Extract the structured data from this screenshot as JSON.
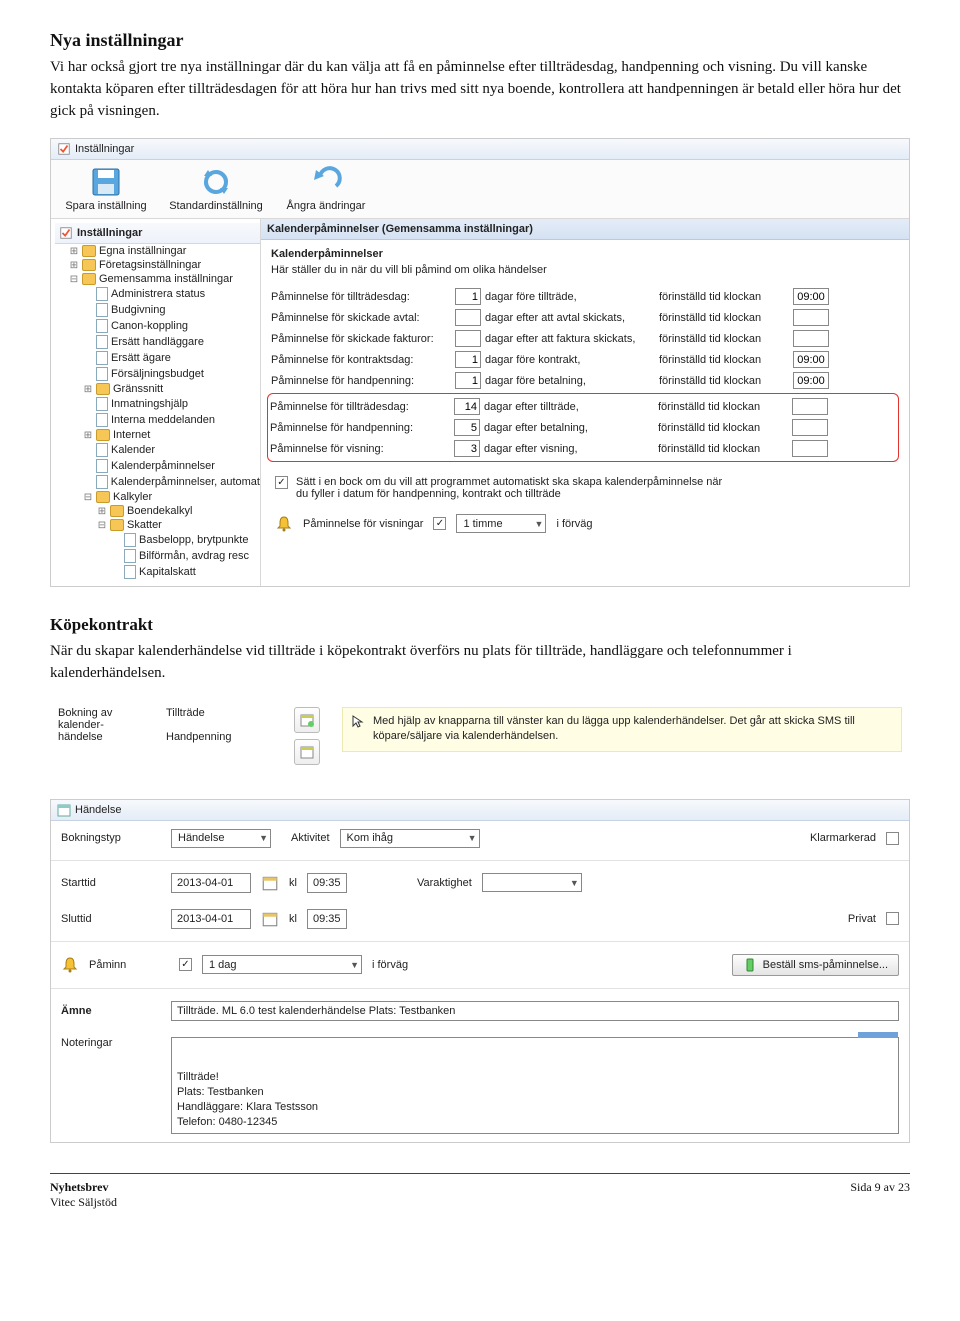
{
  "doc": {
    "h1": "Nya inställningar",
    "p1": "Vi har också gjort tre nya inställningar där du kan välja att få en påminnelse efter tillträdesdag, handpenning och visning. Du vill kanske kontakta köparen efter tillträdesdagen för att höra hur han trivs med sitt nya boende, kontrollera att handpenningen är betald eller höra hur det gick på visningen.",
    "h2": "Köpekontrakt",
    "p2": "När du skapar kalenderhändelse vid tillträde i köpekontrakt överförs nu plats för tillträde, handläggare och telefonnummer i kalenderhändelsen."
  },
  "ss1": {
    "title": "Inställningar",
    "tool_save": "Spara inställning",
    "tool_std": "Standardinställning",
    "tool_undo": "Ångra ändringar",
    "tree_hdr": "Inställningar",
    "tree": [
      "Egna inställningar",
      "Företagsinställningar",
      "Gemensamma inställningar",
      "Administrera status",
      "Budgivning",
      "Canon-koppling",
      "Ersätt handläggare",
      "Ersätt ägare",
      "Försäljningsbudget",
      "Gränssnitt",
      "Inmatningshjälp",
      "Interna meddelanden",
      "Internet",
      "Kalender",
      "Kalenderpåminnelser",
      "Kalenderpåminnelser, automat",
      "Kalkyler",
      "Boendekalkyl",
      "Skatter",
      "Basbelopp, brytpunkte",
      "Bilförmån, avdrag resc",
      "Kapitalskatt"
    ],
    "section": "Kalenderpåminnelser (Gemensamma inställningar)",
    "subtitle": "Kalenderpåminnelser",
    "desc": "Här ställer du in när du vill bli påmind om olika händelser",
    "rows_top": [
      {
        "l": "Påminnelse för tillträdesdag:",
        "v": "1",
        "m": "dagar före tillträde,",
        "p": "förinställd tid klockan",
        "t": "09:00"
      },
      {
        "l": "Påminnelse för skickade avtal:",
        "v": "",
        "m": "dagar efter att avtal skickats,",
        "p": "förinställd tid klockan",
        "t": ""
      },
      {
        "l": "Påminnelse för skickade fakturor:",
        "v": "",
        "m": "dagar efter att faktura skickats,",
        "p": "förinställd tid klockan",
        "t": ""
      },
      {
        "l": "Påminnelse för kontraktsdag:",
        "v": "1",
        "m": "dagar före kontrakt,",
        "p": "förinställd tid klockan",
        "t": "09:00"
      },
      {
        "l": "Påminnelse för handpenning:",
        "v": "1",
        "m": "dagar före betalning,",
        "p": "förinställd tid klockan",
        "t": "09:00"
      }
    ],
    "rows_red": [
      {
        "l": "Påminnelse för tillträdesdag:",
        "v": "14",
        "m": "dagar efter tillträde,",
        "p": "förinställd tid klockan",
        "t": ""
      },
      {
        "l": "Påminnelse för handpenning:",
        "v": "5",
        "m": "dagar efter betalning,",
        "p": "förinställd tid klockan",
        "t": ""
      },
      {
        "l": "Påminnelse för visning:",
        "v": "3",
        "m": "dagar efter visning,",
        "p": "förinställd tid klockan",
        "t": ""
      }
    ],
    "check_text": "Sätt i en bock om du vill att programmet automatiskt ska skapa kalenderpåminnelse när du fyller i datum för handpenning, kontrakt och tillträde",
    "bell_label": "Påminnelse för visningar",
    "bell_value": "1 timme",
    "bell_suffix": "i förväg"
  },
  "ss2": {
    "col1": "Bokning av kalender-händelse",
    "btn1": "Tillträde",
    "btn2": "Handpenning",
    "help": "Med hjälp av knapparna till vänster kan du lägga upp kalenderhändelser. Det går att skicka SMS till köpare/säljare via kalenderhändelsen."
  },
  "ss3": {
    "title": "Händelse",
    "l_bokning": "Bokningstyp",
    "v_bokning": "Händelse",
    "l_aktivitet": "Aktivitet",
    "v_aktivitet": "Kom ihåg",
    "l_klar": "Klarmarkerad",
    "l_start": "Starttid",
    "v_start_d": "2013-04-01",
    "l_kl": "kl",
    "v_start_t": "09:35",
    "l_var": "Varaktighet",
    "l_slut": "Sluttid",
    "v_slut_d": "2013-04-01",
    "v_slut_t": "09:35",
    "l_privat": "Privat",
    "l_paminn": "Påminn",
    "v_paminn": "1 dag",
    "paminn_suffix": "i förväg",
    "btn_sms": "Beställ sms-påminnelse...",
    "l_amne": "Ämne",
    "v_amne": "Tillträde. ML 6.0 test kalenderhändelse Plats: Testbanken",
    "l_not": "Noteringar",
    "v_not": "Tillträde!\nPlats: Testbanken\nHandläggare: Klara Testsson\nTelefon: 0480-12345"
  },
  "footer": {
    "l1": "Nyhetsbrev",
    "l2": "Vitec Säljstöd",
    "r": "Sida 9 av 23"
  }
}
